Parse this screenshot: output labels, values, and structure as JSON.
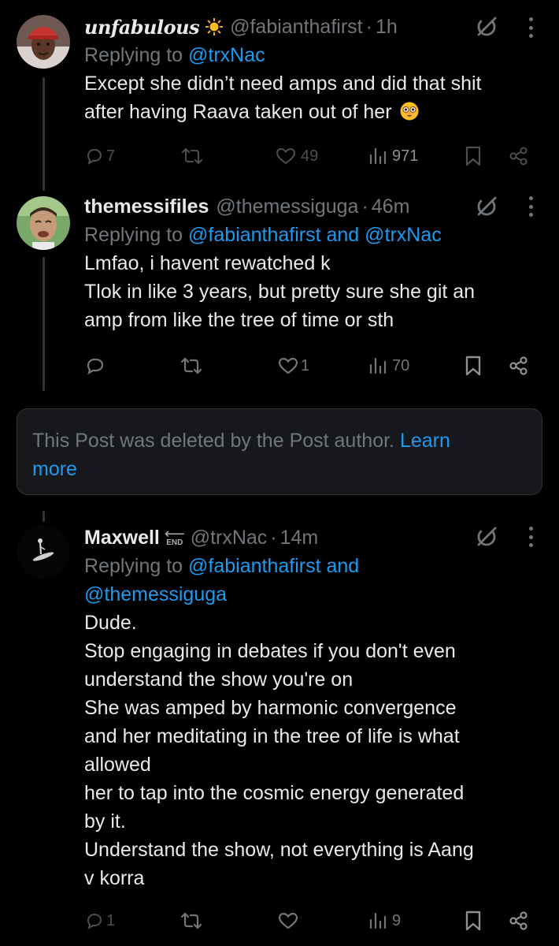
{
  "tweets": [
    {
      "name": "unfabulous",
      "emoji": "sun",
      "handle": "@fabianthafirst",
      "time": "1h",
      "replying_prefix": "Replying to",
      "replying_to": "@trxNac",
      "text_lines": [
        "Except she didn’t need amps and did that shit",
        "after having Raava taken out of her"
      ],
      "replies": "7",
      "reposts": "",
      "likes": "49",
      "views": "971"
    },
    {
      "name": "themessifiles",
      "handle": "@themessiguga",
      "time": "46m",
      "replying_prefix": "Replying to",
      "replying_to": "@fabianthafirst and @trxNac",
      "text_lines": [
        "Lmfao, i havent rewatched k",
        "Tlok in like 3 years, but pretty sure she git an",
        "amp from like the tree of time or sth"
      ],
      "replies": "",
      "reposts": "",
      "likes": "1",
      "views": "70"
    },
    {
      "name": "Maxwell",
      "badge": "END",
      "handle": "@trxNac",
      "time": "14m",
      "replying_prefix": "Replying to",
      "replying_to_lines": [
        "@fabianthafirst and",
        "@themessiguga"
      ],
      "text_lines": [
        "Dude.",
        "Stop engaging in debates if you don't even",
        "understand the show you're on",
        "She was amped by harmonic convergence",
        "and her meditating in the tree of life is what",
        "allowed",
        "her to tap into the cosmic energy generated",
        "by it.",
        "Understand the show, not everything is Aang",
        "v korra"
      ],
      "replies": "1",
      "reposts": "",
      "likes": "",
      "views": "9"
    }
  ],
  "deleted_notice": {
    "text": "This Post was deleted by the Post author.",
    "learn_first": "Learn",
    "learn_second": "more"
  },
  "icons": [
    "reply-icon",
    "repost-icon",
    "like-icon",
    "views-icon",
    "bookmark-icon",
    "share-icon",
    "grok-icon",
    "more-icon"
  ],
  "colors": {
    "background": "#000000",
    "text": "#e7e9ea",
    "muted": "#71767b",
    "link": "#1d9bf0",
    "card": "#16181c"
  }
}
